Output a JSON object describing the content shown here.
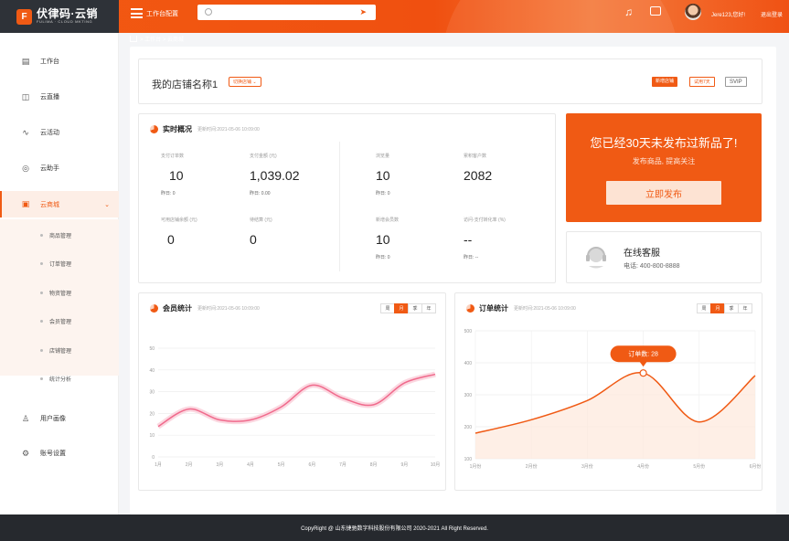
{
  "brand": {
    "name": "伏律码·云销",
    "sub": "FULIMA · CLOUD MKTING",
    "mark": "F"
  },
  "header": {
    "workspace": "工作台配置",
    "search_placeholder": "",
    "greeting": "Jere123,您好!",
    "logout": "退出登录"
  },
  "sidebar": {
    "items": [
      {
        "label": "工作台",
        "icon": "clipboard-icon"
      },
      {
        "label": "云直播",
        "icon": "camera-icon"
      },
      {
        "label": "云活动",
        "icon": "activity-icon"
      },
      {
        "label": "云助手",
        "icon": "check-circle-icon"
      },
      {
        "label": "云商城",
        "icon": "store-icon"
      },
      {
        "label": "用户画像",
        "icon": "user-icon"
      },
      {
        "label": "账号设置",
        "icon": "gear-icon"
      }
    ],
    "sub_items": [
      "商品管理",
      "订单管理",
      "物资管理",
      "会员管理",
      "店铺管理",
      "统计分析"
    ]
  },
  "breadcrumb": "> 工作台 > 云商城",
  "store": {
    "name": "我的店铺名称1",
    "switch": "切换店铺",
    "tags": [
      "新增店铺",
      "试用7天",
      "SVIP"
    ]
  },
  "realtime": {
    "title": "实时概况",
    "updated": "更新时间:2021-05-06 10:09:00",
    "stats": [
      {
        "label": "支付订单数",
        "value": "10",
        "yesterday": "昨日: 0"
      },
      {
        "label": "支付金额 (元)",
        "value": "1,039.02",
        "yesterday": "昨日: 0.00"
      },
      {
        "label": "浏览量",
        "value": "10",
        "yesterday": "昨日: 0"
      },
      {
        "label": "累积客户数",
        "value": "2082",
        "yesterday": ""
      },
      {
        "label": "可用店铺余额 (元)",
        "value": "0",
        "yesterday": ""
      },
      {
        "label": "待结算 (元)",
        "value": "0",
        "yesterday": ""
      },
      {
        "label": "新增会员数",
        "value": "10",
        "yesterday": "昨日: 0"
      },
      {
        "label": "访问-支付转化率 (%)",
        "value": "--",
        "yesterday": "昨日: --"
      }
    ]
  },
  "promo": {
    "headline": "您已经30天未发布过新品了!",
    "sub": "发布商品, 提高关注",
    "button": "立即发布"
  },
  "service": {
    "title": "在线客服",
    "phone": "电话: 400-800-8888"
  },
  "segments": [
    "周",
    "月",
    "季",
    "年"
  ],
  "member_chart_meta": {
    "title": "会员统计",
    "updated": "更新时间:2021-05-06 10:09:00"
  },
  "order_chart_meta": {
    "title": "订单统计",
    "updated": "更新时间:2021-05-06 10:09:00",
    "tooltip": "订单数: 28"
  },
  "chart_data": [
    {
      "type": "line",
      "title": "会员统计",
      "x": [
        "1月",
        "2月",
        "3月",
        "4月",
        "5月",
        "6月",
        "7月",
        "8月",
        "9月",
        "10月"
      ],
      "ylim": [
        0,
        50
      ],
      "yticks": [
        "0",
        "10",
        "20",
        "30",
        "40",
        "50"
      ],
      "series": [
        {
          "values": [
            14,
            22,
            17,
            17,
            23,
            33,
            27,
            24,
            34,
            38
          ]
        }
      ],
      "color": "#f06a8c"
    },
    {
      "type": "area",
      "title": "订单统计",
      "x": [
        "1月份",
        "2月份",
        "3月份",
        "4月份",
        "5月份",
        "6月份"
      ],
      "ylim": [
        100,
        500
      ],
      "yticks": [
        "100",
        "200",
        "300",
        "400",
        "500"
      ],
      "series": [
        {
          "values": [
            180,
            222,
            282,
            368,
            215,
            360
          ]
        }
      ],
      "color": "#f05a14"
    }
  ],
  "footer": "CopyRight @ 山东捷驰数字科技股份有限公司 2020-2021 All Right Reserved."
}
